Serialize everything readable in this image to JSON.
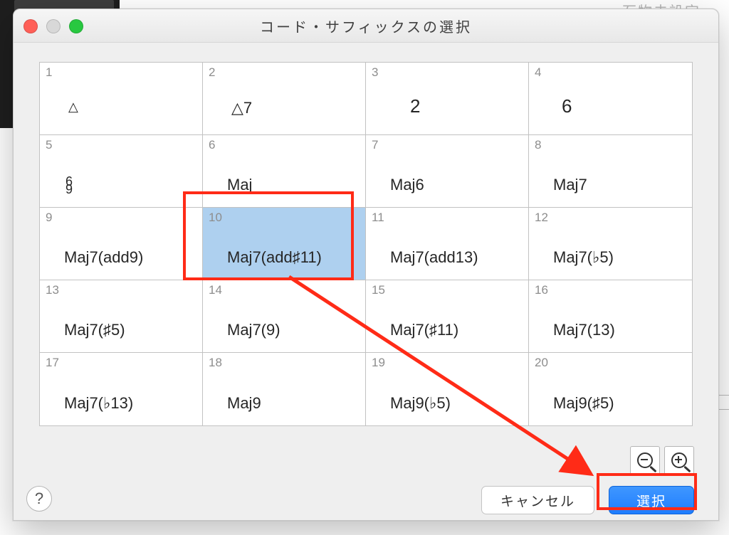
{
  "window": {
    "title": "コード・サフィックスの選択",
    "behind_label": "石物未設定"
  },
  "cells": [
    {
      "num": "1",
      "label": "△"
    },
    {
      "num": "2",
      "label": "△7"
    },
    {
      "num": "3",
      "label": "2"
    },
    {
      "num": "4",
      "label": "6"
    },
    {
      "num": "5",
      "label": "6\n9"
    },
    {
      "num": "6",
      "label": "Maj"
    },
    {
      "num": "7",
      "label": "Maj6"
    },
    {
      "num": "8",
      "label": "Maj7"
    },
    {
      "num": "9",
      "label": "Maj7(add9)"
    },
    {
      "num": "10",
      "label": "Maj7(add♯11)",
      "selected": true
    },
    {
      "num": "11",
      "label": "Maj7(add13)"
    },
    {
      "num": "12",
      "label": "Maj7(♭5)"
    },
    {
      "num": "13",
      "label": "Maj7(♯5)"
    },
    {
      "num": "14",
      "label": "Maj7(9)"
    },
    {
      "num": "15",
      "label": "Maj7(♯11)"
    },
    {
      "num": "16",
      "label": "Maj7(13)"
    },
    {
      "num": "17",
      "label": "Maj7(♭13)"
    },
    {
      "num": "18",
      "label": "Maj9"
    },
    {
      "num": "19",
      "label": "Maj9(♭5)"
    },
    {
      "num": "20",
      "label": "Maj9(♯5)"
    }
  ],
  "buttons": {
    "cancel": "キャンセル",
    "select": "選択"
  },
  "help": "?"
}
